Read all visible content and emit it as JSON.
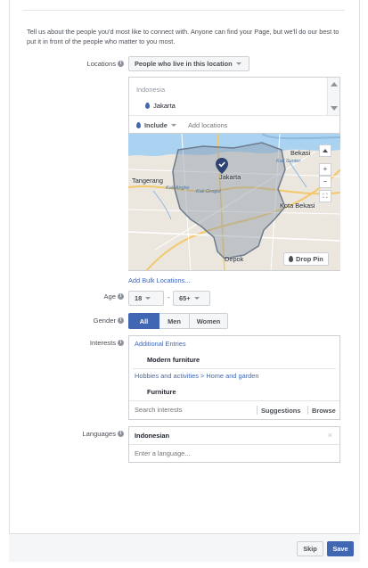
{
  "intro": "Tell us about the people you'd most like to connect with. Anyone can find your Page, but we'll do our best to put it in front of the people who matter to you most.",
  "locations": {
    "label": "Locations",
    "dropdown": "People who live in this location",
    "country": "Indonesia",
    "city": "Jakarta",
    "include": "Include",
    "add_placeholder": "Add locations",
    "drop_pin": "Drop Pin",
    "bulk_link": "Add Bulk Locations...",
    "map_labels": {
      "jakarta": "Jakarta",
      "tangerang": "Tangerang",
      "bekasi": "Bekasi",
      "kota_bekasi": "Kota Bekasi",
      "depok": "Depok",
      "kali_angke": "Kali Angke",
      "kali_sunter": "Kali Sunter",
      "kali_grogol": "Kali Grogol"
    }
  },
  "age": {
    "label": "Age",
    "min": "18",
    "separator": "-",
    "max": "65+"
  },
  "gender": {
    "label": "Gender",
    "options": [
      "All",
      "Men",
      "Women"
    ],
    "selected": "All"
  },
  "interests": {
    "label": "Interests",
    "groups": [
      {
        "category": "Additional Entries",
        "item": "Modern furniture"
      },
      {
        "category": "Hobbies and activities > Home and garden",
        "item": "Furniture"
      }
    ],
    "search_placeholder": "Search interests",
    "suggestions": "Suggestions",
    "browse": "Browse"
  },
  "languages": {
    "label": "Languages",
    "selected": "Indonesian",
    "placeholder": "Enter a language..."
  },
  "footer": {
    "skip": "Skip",
    "save": "Save"
  },
  "colors": {
    "primary": "#4267b2",
    "border": "#ccd0d5",
    "text": "#4b4f56"
  }
}
